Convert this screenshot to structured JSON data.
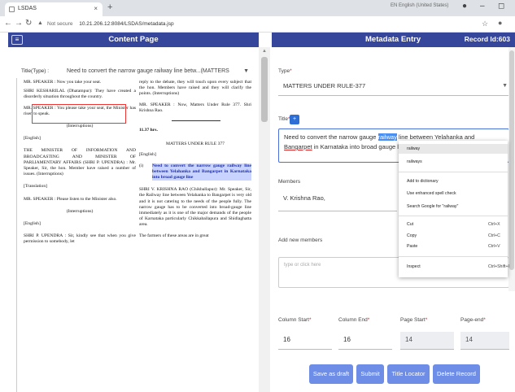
{
  "browser": {
    "tab_title": "LSDAS",
    "tab_close": "×",
    "new_tab": "+",
    "profile": "EN English (United States)",
    "url_prefix": "Not secure",
    "url": "10.21.206.12:8084/LSDAS/metadata.jsp"
  },
  "left_panel": {
    "header": "Content Page",
    "title_label": "Title(Type) :",
    "title_select_value": "Need to convert the narrow gauge railway line betw...(MATTERS"
  },
  "document": {
    "left_col": [
      "MR. SPEAKER : Now you take your seat.",
      "SHRI KESHARILAL (Dhatampur): They have created a disorderly situation throughout the country.",
      "MR. SPEAKER : You please take your seat, the Minister has risen to speak.",
      "(Interruptions)",
      "[English]",
      "THE MINISTER OF INFORMATION AND BROADCASTING AND MINISTER OF PARLIAMENTARY AFFAIRS (SHRI P. UPENDRA) : Mr. Speaker, Sir, the hon. Member have raised a number of issues. (Interruptions)",
      "[Translation]",
      "MR. SPEAKER : Please listen to the Minister also.",
      "(Interruptions)",
      "[English]",
      "SHRI P. UPENDRA : Sir, kindly see that when you give permission to somebody, let"
    ],
    "right_col": [
      "reply to the debate, they will touch upon every subject that the hon. Members have raised and they will clarify the points. (Interruptions)",
      "MR. SPEAKER : Now, Matters Under Rule 377. Shri Krishna Rao.",
      "11.37 hrs.",
      "MATTERS UNDER RULE 377",
      "[English]",
      "(i)",
      "Need to convert the narrow gauge railway line between Yelahanka and Bangarpet in Karnataka into broad gauge line",
      "SHRI V. KRISHNA RAO (Chikballapur): Mr. Speaker, Sir, the Railway line between Yelahanka to Bangarpet is very old and it is not catering to the needs of the people fully. The narrow gauge has to be converted into broad-gauge line immediately as it is one of the major demands of the people of Karnataka particularly Chikkaballapura and Shidlaghatta area.",
      "The farmers of these areas are in great"
    ]
  },
  "right_panel": {
    "header": "Metadata Entry",
    "record_label": "Record Id:603",
    "type_label": "Type",
    "type_value": "MATTERS UNDER RULE-377",
    "title_label": "Title",
    "title_badge": "+",
    "title_text_before": "Need to convert the narrow gauge ",
    "title_text_selected": "railway",
    "title_text_after": " line between Yelahanka and",
    "title_line2_spell": "Bangarpet",
    "title_line2_rest": " in Karnataka into broad gauge li",
    "members_label": "Members",
    "members_value": "V. Krishna Rao,",
    "add_members_label": "Add new members",
    "add_members_placeholder": "type or click here",
    "column_start_label": "Column Start",
    "column_start_value": "16",
    "column_end_label": "Column End",
    "column_end_value": "16",
    "page_start_label": "Page Start",
    "page_start_value": "14",
    "page_end_label": "Page-end",
    "page_end_value": "14",
    "required_mark": "*",
    "buttons": {
      "save_draft": "Save as draft",
      "submit": "Submit",
      "title_locator": "Title Locator",
      "delete_record": "Delete Record"
    }
  },
  "context_menu": {
    "suggestion1": "railway",
    "suggestion2": "railways",
    "add_dict": "Add to dictionary",
    "enhanced": "Use enhanced spell check",
    "search_google": "Search Google for \"railway\"",
    "cut": "Cut",
    "cut_sc": "Ctrl+X",
    "copy": "Copy",
    "copy_sc": "Ctrl+C",
    "paste": "Paste",
    "paste_sc": "Ctrl+V",
    "inspect": "Inspect",
    "inspect_sc": "Ctrl+Shift+I"
  },
  "colors": {
    "header_bg": "#36469b",
    "button_bg": "#6d8de6",
    "highlight": "#c8d3ff"
  }
}
